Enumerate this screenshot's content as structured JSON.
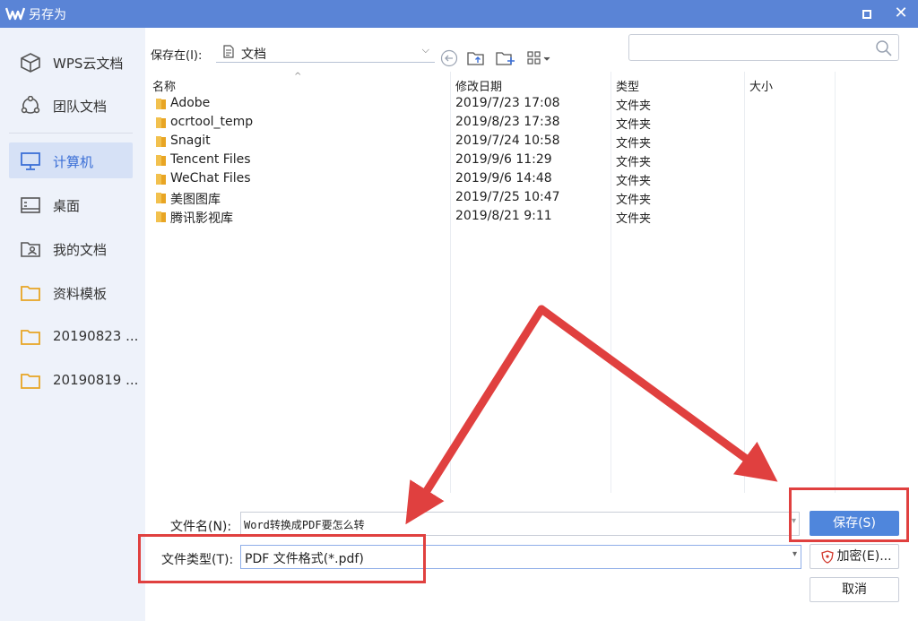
{
  "window": {
    "title": "另存为"
  },
  "sidebar": {
    "items": [
      {
        "label": "WPS云文档",
        "icon": "cube-icon",
        "active": false
      },
      {
        "label": "团队文档",
        "icon": "team-icon",
        "active": false
      },
      {
        "label": "计算机",
        "icon": "monitor-icon",
        "active": true
      },
      {
        "label": "桌面",
        "icon": "desktop-icon",
        "active": false
      },
      {
        "label": "我的文档",
        "icon": "my-documents-icon",
        "active": false
      },
      {
        "label": "资料模板",
        "icon": "folder-icon",
        "active": false
      },
      {
        "label": "20190823 ...",
        "icon": "folder-icon",
        "active": false
      },
      {
        "label": "20190819 ...",
        "icon": "folder-icon",
        "active": false
      }
    ]
  },
  "location": {
    "label": "保存在(I):",
    "value": "文档"
  },
  "search": {
    "placeholder": ""
  },
  "file_list": {
    "columns": [
      "名称",
      "修改日期",
      "类型",
      "大小"
    ],
    "rows": [
      {
        "name": "Adobe",
        "date": "2019/7/23 17:08",
        "type": "文件夹"
      },
      {
        "name": "ocrtool_temp",
        "date": "2019/8/23 17:38",
        "type": "文件夹"
      },
      {
        "name": "Snagit",
        "date": "2019/7/24 10:58",
        "type": "文件夹"
      },
      {
        "name": "Tencent Files",
        "date": "2019/9/6 11:29",
        "type": "文件夹"
      },
      {
        "name": "WeChat Files",
        "date": "2019/9/6 14:48",
        "type": "文件夹"
      },
      {
        "name": "美图图库",
        "date": "2019/7/25 10:47",
        "type": "文件夹"
      },
      {
        "name": "腾讯影视库",
        "date": "2019/8/21 9:11",
        "type": "文件夹"
      }
    ]
  },
  "form": {
    "filename_label": "文件名(N):",
    "filename_value": "Word转换成PDF要怎么转",
    "filetype_label": "文件类型(T):",
    "filetype_value": "PDF 文件格式(*.pdf)"
  },
  "buttons": {
    "save": "保存(S)",
    "encrypt": "加密(E)...",
    "cancel": "取消"
  },
  "colors": {
    "titlebar": "#5a84d6",
    "accent": "#4f86dc",
    "annotation": "#e0403f"
  }
}
